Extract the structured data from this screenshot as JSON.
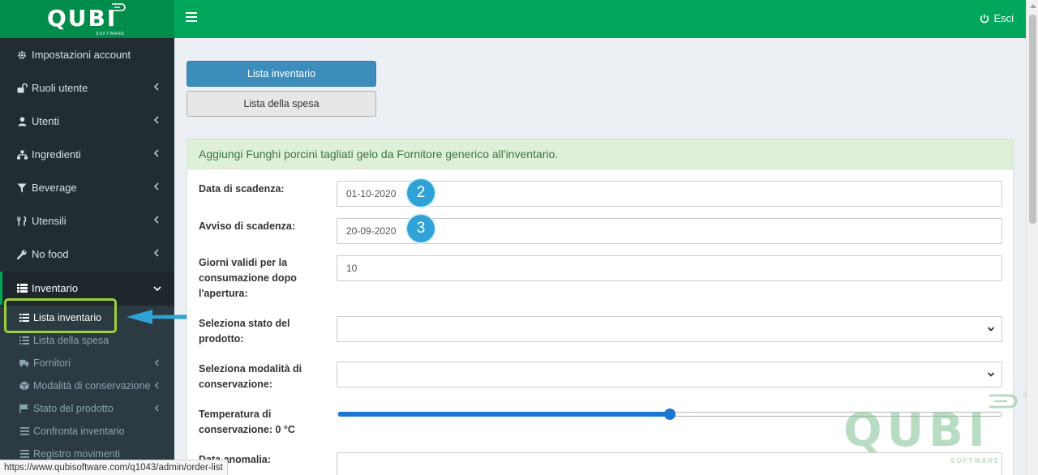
{
  "header": {
    "logo_text": "QUBI",
    "logo_subtext": "SOFTWARE",
    "logout_label": "Esci"
  },
  "sidebar": {
    "items": [
      {
        "label": "Impostazioni account",
        "icon": "gear-icon"
      },
      {
        "label": "Ruoli utente",
        "icon": "unlock-icon"
      },
      {
        "label": "Utenti",
        "icon": "user-icon"
      },
      {
        "label": "Ingredienti",
        "icon": "sitemap-icon"
      },
      {
        "label": "Beverage",
        "icon": "filter-icon"
      },
      {
        "label": "Utensili",
        "icon": "cutlery-icon"
      },
      {
        "label": "No food",
        "icon": "wrench-icon"
      },
      {
        "label": "Inventario",
        "icon": "list-icon"
      }
    ],
    "submenu": [
      {
        "label": "Lista inventario",
        "icon": "list-icon"
      },
      {
        "label": "Lista della spesa",
        "icon": "list-ol-icon"
      },
      {
        "label": "Fornitori",
        "icon": "truck-icon"
      },
      {
        "label": "Modalità di conservazione",
        "icon": "cube-icon"
      },
      {
        "label": "Stato del prodotto",
        "icon": "flag-icon"
      },
      {
        "label": "Confronta inventario",
        "icon": "bars-icon"
      },
      {
        "label": "Registro movimenti",
        "icon": "bars-icon"
      }
    ]
  },
  "buttons": {
    "inventory_list": "Lista inventario",
    "shopping_list": "Lista della spesa"
  },
  "form": {
    "heading": "Aggiungi Funghi porcini tagliati gelo da Fornitore generico all'inventario.",
    "expiry_date_label": "Data di scadenza:",
    "expiry_date_value": "01-10-2020",
    "expiry_notice_label": "Avviso di scadenza:",
    "expiry_notice_value": "20-09-2020",
    "valid_days_label": "Giorni validi per la consumazione dopo l'apertura:",
    "valid_days_value": "10",
    "product_state_label": "Seleziona stato del prodotto:",
    "product_state_value": "",
    "storage_mode_label": "Seleziona modalità di conservazione:",
    "storage_mode_value": "",
    "temperature_label": "Temperatura di conservazione: 0 °C",
    "temperature_fraction": 0.5,
    "anomaly_date_label": "Data anomalia:"
  },
  "annotations": {
    "step2": "2",
    "step3": "3"
  },
  "watermark": {
    "text": "QUBI",
    "subtext": "SOFTWARE",
    "registered": "®"
  },
  "statusbar": {
    "url": "https://www.qubisoftware.com/q1043/admin/order-list"
  },
  "colors": {
    "brand_green": "#00a65a",
    "sidebar_dark": "#222d32",
    "primary_blue": "#3c8dbc",
    "highlight_lime": "#9bd13a",
    "annotation_blue": "#2fa3d6"
  }
}
